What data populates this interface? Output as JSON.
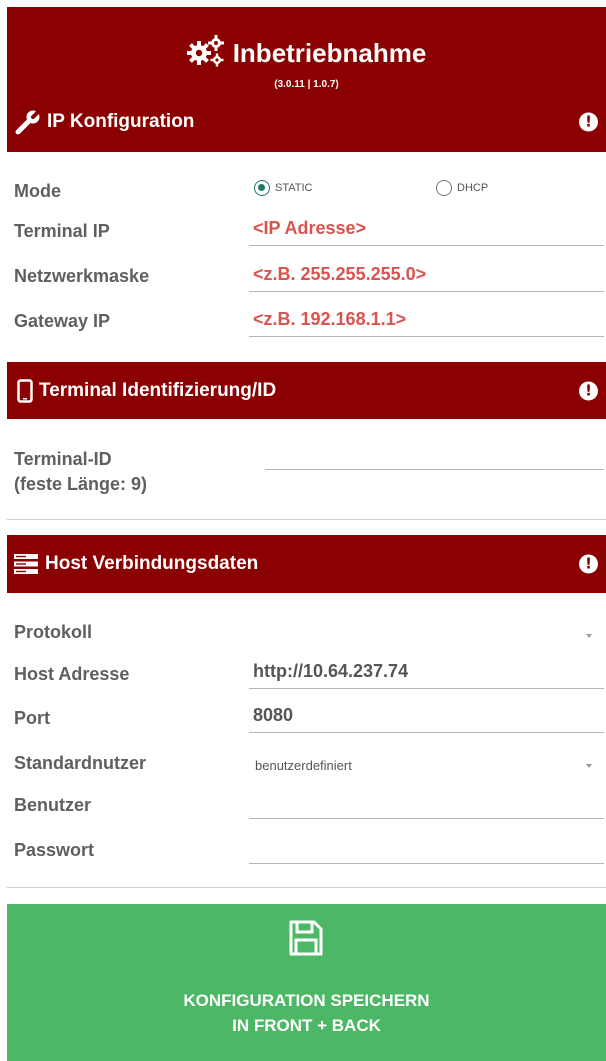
{
  "header": {
    "title": "Inbetriebnahme",
    "version": "(3.0.11 | 1.0.7)"
  },
  "ip_section": {
    "title": "IP Konfiguration",
    "mode_label": "Mode",
    "mode_options": [
      "STATIC",
      "DHCP"
    ],
    "mode_selected": "STATIC",
    "terminal_ip_label": "Terminal IP",
    "terminal_ip_placeholder": "<IP Adresse>",
    "netmask_label": "Netzwerkmaske",
    "netmask_placeholder": "<z.B. 255.255.255.0>",
    "gateway_label": "Gateway IP",
    "gateway_placeholder": "<z.B. 192.168.1.1>"
  },
  "terminal_section": {
    "title": "Terminal Identifizierung/ID",
    "terminal_id_label_line1": "Terminal-ID",
    "terminal_id_label_line2": "(feste Länge: 9)",
    "terminal_id_value": ""
  },
  "host_section": {
    "title": "Host Verbindungsdaten",
    "protocol_label": "Protokoll",
    "protocol_value": "",
    "host_label": "Host Adresse",
    "host_value": "http://10.64.237.74",
    "port_label": "Port",
    "port_value": "8080",
    "standard_user_label": "Standardnutzer",
    "standard_user_value": "benutzerdefiniert",
    "user_label": "Benutzer",
    "user_value": "",
    "password_label": "Passwort",
    "password_value": ""
  },
  "save_button": {
    "line1": "KONFIGURATION SPEICHERN",
    "line2": "IN FRONT + BACK"
  },
  "colors": {
    "header": "#8b0000",
    "save": "#4cb866",
    "placeholder": "#d9534f",
    "radio_selected": "#1a7a62"
  }
}
